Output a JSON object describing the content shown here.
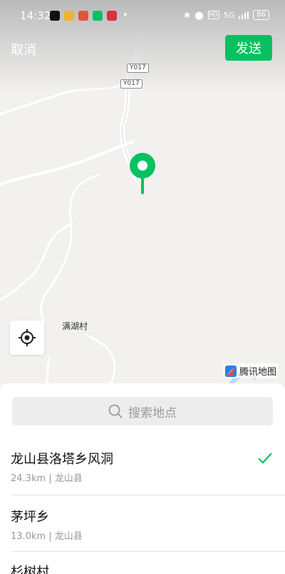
{
  "status_bar": {
    "time": "14:32",
    "network": "5G",
    "hd": "HD",
    "battery": "86"
  },
  "header": {
    "cancel_label": "取消",
    "send_label": "发送"
  },
  "map": {
    "road_labels": [
      "Y017",
      "Y017"
    ],
    "village_label": "满湖村",
    "brand": "腾讯地图"
  },
  "search": {
    "placeholder": "搜索地点"
  },
  "results": [
    {
      "name": "龙山县洛塔乡风洞",
      "meta": "24.3km | 龙山县",
      "selected": true
    },
    {
      "name": "茅坪乡",
      "meta": "13.0km | 龙山县",
      "selected": false
    },
    {
      "name": "杉树村",
      "meta": "",
      "selected": false
    }
  ],
  "colors": {
    "accent": "#07c160",
    "map_bg": "#f2f1ef"
  }
}
